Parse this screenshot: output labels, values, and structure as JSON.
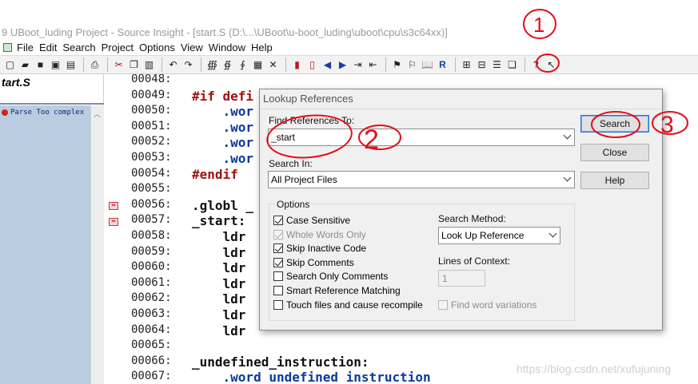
{
  "window": {
    "title": "9 UBoot_luding Project - Source Insight - [start.S (D:\\...\\UBoot\\u-boot_luding\\uboot\\cpu\\s3c64xx)]"
  },
  "menu": [
    "File",
    "Edit",
    "Search",
    "Project",
    "Options",
    "View",
    "Window",
    "Help"
  ],
  "left_panel": {
    "file_tab": "tart.S",
    "symbol_item": "Parse Too complex"
  },
  "code_lines": [
    {
      "num": "00048:",
      "text": "",
      "style": "plain"
    },
    {
      "num": "00049:",
      "text": "#if defi",
      "style": "pp"
    },
    {
      "num": "00050:",
      "text": "    .wor",
      "style": "dir"
    },
    {
      "num": "00051:",
      "text": "    .wor",
      "style": "dir"
    },
    {
      "num": "00052:",
      "text": "    .wor",
      "style": "dir"
    },
    {
      "num": "00053:",
      "text": "    .wor",
      "style": "dir"
    },
    {
      "num": "00054:",
      "text": "#endif",
      "style": "pp"
    },
    {
      "num": "00055:",
      "text": "",
      "style": "plain"
    },
    {
      "num": "00056:",
      "text": ".globl _",
      "style": "plain"
    },
    {
      "num": "00057:",
      "text": "_start:",
      "style": "plain"
    },
    {
      "num": "00058:",
      "text": "    ldr",
      "style": "plain"
    },
    {
      "num": "00059:",
      "text": "    ldr",
      "style": "plain"
    },
    {
      "num": "00060:",
      "text": "    ldr",
      "style": "plain"
    },
    {
      "num": "00061:",
      "text": "    ldr",
      "style": "plain"
    },
    {
      "num": "00062:",
      "text": "    ldr",
      "style": "plain"
    },
    {
      "num": "00063:",
      "text": "    ldr",
      "style": "plain"
    },
    {
      "num": "00064:",
      "text": "    ldr",
      "style": "plain"
    },
    {
      "num": "00065:",
      "text": "",
      "style": "plain"
    },
    {
      "num": "00066:",
      "text": "_undefined_instruction:",
      "style": "plain"
    },
    {
      "num": "00067:",
      "text": "    .word undefined instruction",
      "style": "dir"
    }
  ],
  "dialog": {
    "title": "Lookup References",
    "find_label": "Find References To:",
    "find_value": "_start",
    "search_in_label": "Search In:",
    "search_in_value": "All Project Files",
    "buttons": {
      "search": "Search",
      "close": "Close",
      "help": "Help"
    },
    "options_label": "Options",
    "options": [
      {
        "label": "Case Sensitive",
        "checked": true,
        "enabled": true
      },
      {
        "label": "Whole Words Only",
        "checked": true,
        "enabled": false
      },
      {
        "label": "Skip Inactive Code",
        "checked": true,
        "enabled": true
      },
      {
        "label": "Skip Comments",
        "checked": true,
        "enabled": true
      },
      {
        "label": "Search Only Comments",
        "checked": false,
        "enabled": true
      },
      {
        "label": "Smart Reference Matching",
        "checked": false,
        "enabled": true
      },
      {
        "label": "Touch files and cause recompile",
        "checked": false,
        "enabled": true
      }
    ],
    "search_method_label": "Search Method:",
    "search_method_value": "Look Up Reference",
    "lines_of_context_label": "Lines of Context:",
    "lines_of_context_value": "1",
    "find_word_variations": {
      "label": "Find word variations",
      "checked": false,
      "enabled": false
    }
  },
  "annotations": [
    "1",
    "2",
    "3"
  ],
  "watermark": "https://blog.csdn.net/xufujuning",
  "colors": {
    "annotation_red": "#e0101a",
    "symbol_panel": "#b9cce0",
    "preprocessor": "#a01010",
    "directive": "#0a3a9a"
  }
}
